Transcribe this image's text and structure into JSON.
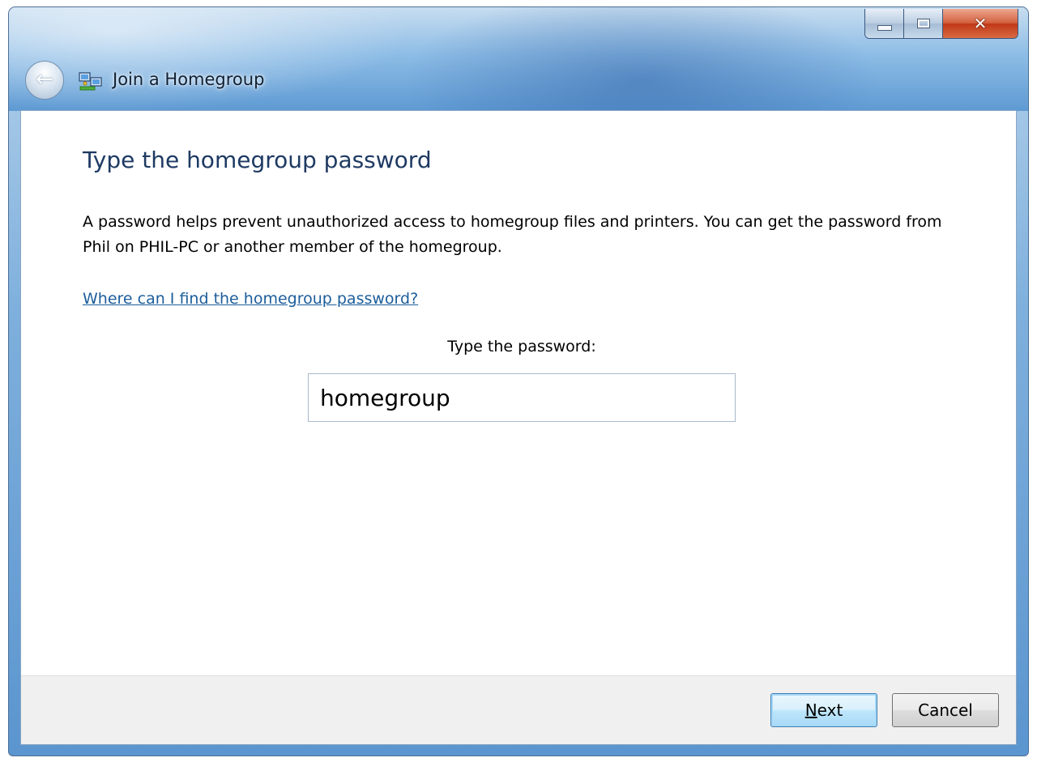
{
  "window": {
    "title": "Join a Homegroup",
    "caption_buttons": {
      "minimize": "minimize",
      "maximize": "maximize",
      "close": "close"
    },
    "close_glyph": "✕",
    "back_glyph": "←"
  },
  "main": {
    "heading": "Type the homegroup password",
    "description": "A password helps prevent unauthorized access to homegroup files and printers. You can get the password from Phil on PHIL-PC or another member of the homegroup.",
    "help_link": "Where can I find the homegroup password?",
    "password_label": "Type the password:",
    "password_value": "homegroup"
  },
  "footer": {
    "next_mnemonic": "N",
    "next_rest": "ext",
    "cancel_label": "Cancel"
  },
  "colors": {
    "heading": "#1e3a63",
    "link": "#1c5d9b",
    "chrome": "#5e9ad3",
    "close": "#c13818"
  },
  "icons": [
    "back-arrow-icon",
    "homegroup-icon",
    "minimize-icon",
    "maximize-icon",
    "close-icon"
  ]
}
